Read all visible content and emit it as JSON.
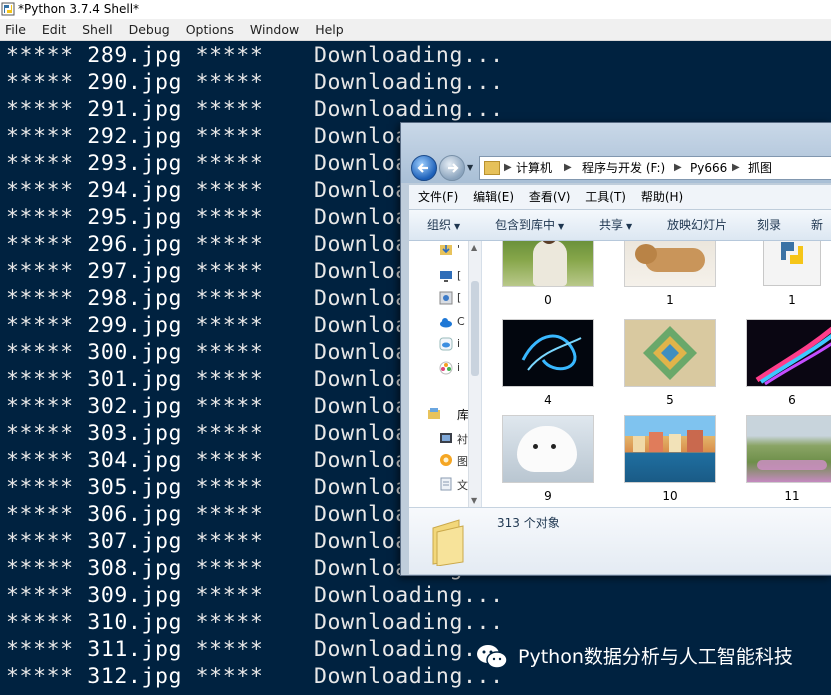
{
  "shell": {
    "title": "*Python 3.7.4 Shell*",
    "menu": [
      "File",
      "Edit",
      "Shell",
      "Debug",
      "Options",
      "Window",
      "Help"
    ],
    "log": [
      {
        "file": "289.jpg",
        "status": "Downloading..."
      },
      {
        "file": "290.jpg",
        "status": "Downloading..."
      },
      {
        "file": "291.jpg",
        "status": "Downloading..."
      },
      {
        "file": "292.jpg",
        "status": "Downloading..."
      },
      {
        "file": "293.jpg",
        "status": "Downloading..."
      },
      {
        "file": "294.jpg",
        "status": "Downloading..."
      },
      {
        "file": "295.jpg",
        "status": "Downloading..."
      },
      {
        "file": "296.jpg",
        "status": "Downloading..."
      },
      {
        "file": "297.jpg",
        "status": "Downloading..."
      },
      {
        "file": "298.jpg",
        "status": "Downloading..."
      },
      {
        "file": "299.jpg",
        "status": "Downloading..."
      },
      {
        "file": "300.jpg",
        "status": "Downloading..."
      },
      {
        "file": "301.jpg",
        "status": "Downloading..."
      },
      {
        "file": "302.jpg",
        "status": "Downloading..."
      },
      {
        "file": "303.jpg",
        "status": "Downloading..."
      },
      {
        "file": "304.jpg",
        "status": "Downloading..."
      },
      {
        "file": "305.jpg",
        "status": "Downloading..."
      },
      {
        "file": "306.jpg",
        "status": "Downloading..."
      },
      {
        "file": "307.jpg",
        "status": "Downloading..."
      },
      {
        "file": "308.jpg",
        "status": "Downloading..."
      },
      {
        "file": "309.jpg",
        "status": "Downloading..."
      },
      {
        "file": "310.jpg",
        "status": "Downloading..."
      },
      {
        "file": "311.jpg",
        "status": "Downloading..."
      },
      {
        "file": "312.jpg",
        "status": "Downloading..."
      }
    ],
    "star_marker": "*****",
    "colors": {
      "background": "#002240",
      "text": "#ffffff"
    }
  },
  "explorer": {
    "breadcrumbs": [
      "计算机",
      "程序与开发 (F:)",
      "Py666",
      "抓图"
    ],
    "menu": [
      "文件(F)",
      "编辑(E)",
      "查看(V)",
      "工具(T)",
      "帮助(H)"
    ],
    "toolbar": {
      "organize": "组织",
      "include_in_library": "包含到库中",
      "share": "共享",
      "slideshow": "放映幻灯片",
      "burn": "刻录",
      "new_folder": "新建"
    },
    "nav_pane": {
      "library_label": "库",
      "icons": [
        "download-icon",
        "desktop-icon",
        "recent-places-icon",
        "onedrive-icon",
        "icloud-icon",
        "photos-icon",
        "library-icon",
        "videos-icon",
        "pictures-icon",
        "documents-icon"
      ]
    },
    "files": [
      {
        "name": "0",
        "thumb": "girl-in-grass"
      },
      {
        "name": "1",
        "thumb": "sleeping-kitten"
      },
      {
        "name": "1",
        "thumb": "python-file-icon"
      },
      {
        "name": "4",
        "thumb": "blue-neon-swirl"
      },
      {
        "name": "5",
        "thumb": "abstract-geometric"
      },
      {
        "name": "6",
        "thumb": "rainbow-light-streaks"
      },
      {
        "name": "9",
        "thumb": "white-puppy"
      },
      {
        "name": "10",
        "thumb": "seaside-town"
      },
      {
        "name": "11",
        "thumb": "flower-field"
      }
    ],
    "status": {
      "count": "313 个对象"
    }
  },
  "watermark": {
    "text": "Python数据分析与人工智能科技",
    "icon": "wechat-icon"
  }
}
